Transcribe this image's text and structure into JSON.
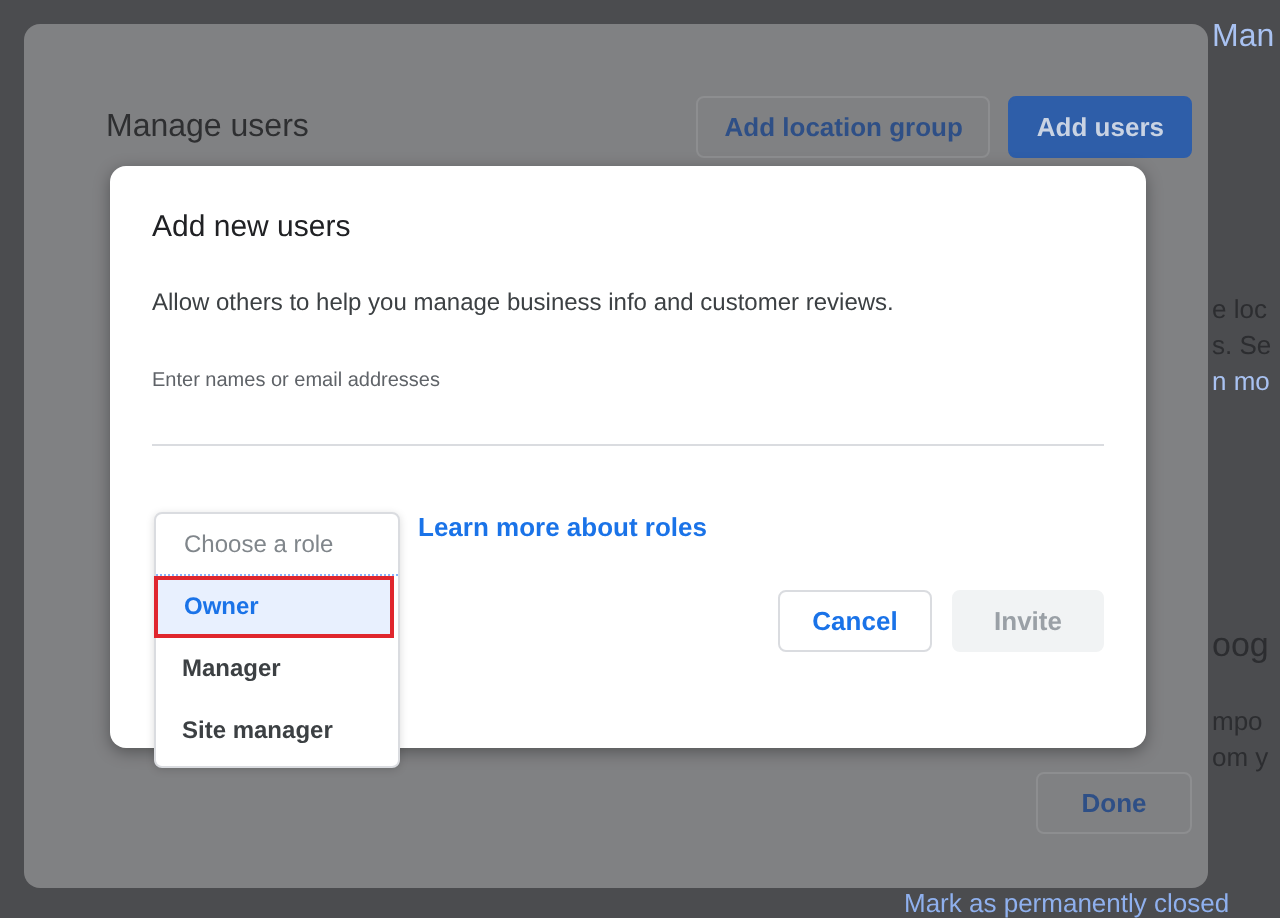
{
  "background_page": {
    "side_texts": [
      {
        "text": "Man",
        "kind": "link"
      },
      {
        "text": "e loc",
        "kind": "text"
      },
      {
        "text": "s. Se",
        "kind": "text"
      },
      {
        "text": "n mo",
        "kind": "link"
      },
      {
        "text": "oog",
        "kind": "heading"
      },
      {
        "text": "mpo",
        "kind": "text"
      },
      {
        "text": "om y",
        "kind": "text"
      }
    ],
    "bottom_link": "Mark as permanently closed"
  },
  "manage_users": {
    "title": "Manage users",
    "buttons": [
      {
        "label": "Add location group",
        "kind": "outlined"
      },
      {
        "label": "Add users",
        "kind": "filled"
      }
    ],
    "done": "Done"
  },
  "add_users": {
    "title": "Add new users",
    "description": "Allow others to help you manage business info and customer reviews.",
    "field": {
      "placeholder": "Enter names or email addresses"
    },
    "role_menu": {
      "placeholder": "Choose a role",
      "items": [
        {
          "label": "Owner",
          "selected": true
        },
        {
          "label": "Manager",
          "selected": false
        },
        {
          "label": "Site manager",
          "selected": false
        }
      ]
    },
    "link": "Learn more about roles",
    "buttons": [
      {
        "label": "Cancel",
        "disabled": false
      },
      {
        "label": "Invite",
        "disabled": true
      }
    ]
  }
}
